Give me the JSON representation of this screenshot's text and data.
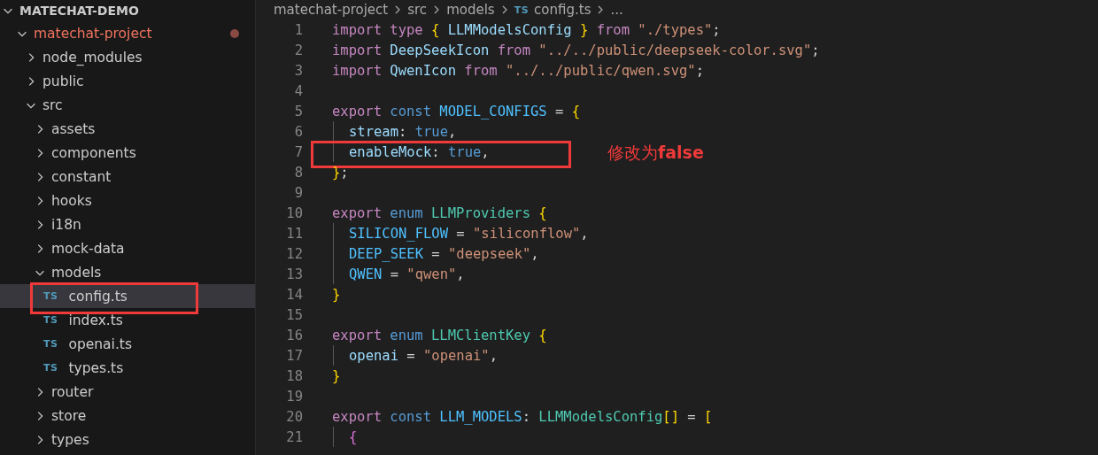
{
  "explorer": {
    "title": "MATECHAT-DEMO",
    "expanded": true,
    "items": [
      {
        "label": "matechat-project",
        "kind": "folder",
        "expanded": true,
        "modified": true,
        "selected": false,
        "children": [
          {
            "label": "node_modules",
            "kind": "folder",
            "expanded": false,
            "selected": false
          },
          {
            "label": "public",
            "kind": "folder",
            "expanded": false,
            "selected": false
          },
          {
            "label": "src",
            "kind": "folder",
            "expanded": true,
            "selected": false,
            "children": [
              {
                "label": "assets",
                "kind": "folder",
                "expanded": false,
                "selected": false
              },
              {
                "label": "components",
                "kind": "folder",
                "expanded": false,
                "selected": false
              },
              {
                "label": "constant",
                "kind": "folder",
                "expanded": false,
                "selected": false
              },
              {
                "label": "hooks",
                "kind": "folder",
                "expanded": false,
                "selected": false
              },
              {
                "label": "i18n",
                "kind": "folder",
                "expanded": false,
                "selected": false
              },
              {
                "label": "mock-data",
                "kind": "folder",
                "expanded": false,
                "selected": false
              },
              {
                "label": "models",
                "kind": "folder",
                "expanded": true,
                "selected": false,
                "children": [
                  {
                    "label": "config.ts",
                    "kind": "file",
                    "badge": "TS",
                    "selected": true,
                    "boxed": true
                  },
                  {
                    "label": "index.ts",
                    "kind": "file",
                    "badge": "TS",
                    "selected": false
                  },
                  {
                    "label": "openai.ts",
                    "kind": "file",
                    "badge": "TS",
                    "selected": false
                  },
                  {
                    "label": "types.ts",
                    "kind": "file",
                    "badge": "TS",
                    "selected": false
                  }
                ]
              },
              {
                "label": "router",
                "kind": "folder",
                "expanded": false,
                "selected": false
              },
              {
                "label": "store",
                "kind": "folder",
                "expanded": false,
                "selected": false
              },
              {
                "label": "types",
                "kind": "folder",
                "expanded": false,
                "selected": false
              }
            ]
          }
        ]
      }
    ]
  },
  "breadcrumb": {
    "parts": [
      "matechat-project",
      "src",
      "models"
    ],
    "file_badge": "TS",
    "file": "config.ts",
    "more": "..."
  },
  "code": [
    {
      "number": "1",
      "tokens": [
        {
          "t": "import",
          "kind": "keyword"
        },
        {
          "t": " type",
          "kind": "keyword"
        },
        {
          "t": " {",
          "kind": "bracket"
        },
        {
          "t": " LLMModelsConfig",
          "kind": "variable"
        },
        {
          "t": " }",
          "kind": "bracket"
        },
        {
          "t": " from",
          "kind": "keyword"
        },
        {
          "t": " \"./types\"",
          "kind": "string"
        },
        {
          "t": ";",
          "kind": "punct"
        }
      ]
    },
    {
      "number": "2",
      "tokens": [
        {
          "t": "import",
          "kind": "keyword"
        },
        {
          "t": " DeepSeekIcon",
          "kind": "variable"
        },
        {
          "t": " from",
          "kind": "keyword"
        },
        {
          "t": " \"../../public/deepseek-color.svg\"",
          "kind": "string"
        },
        {
          "t": ";",
          "kind": "punct"
        }
      ]
    },
    {
      "number": "3",
      "tokens": [
        {
          "t": "import",
          "kind": "keyword"
        },
        {
          "t": " QwenIcon",
          "kind": "variable"
        },
        {
          "t": " from",
          "kind": "keyword"
        },
        {
          "t": " \"../../public/qwen.svg\"",
          "kind": "string"
        },
        {
          "t": ";",
          "kind": "punct"
        }
      ]
    },
    {
      "number": "4"
    },
    {
      "number": "5",
      "tokens": [
        {
          "t": "export",
          "kind": "keyword"
        },
        {
          "t": " const",
          "kind": "storage"
        },
        {
          "t": " MODEL_CONFIGS",
          "kind": "constant"
        },
        {
          "t": " =",
          "kind": "punct"
        },
        {
          "t": " {",
          "kind": "bracket"
        }
      ]
    },
    {
      "number": "6",
      "indent": true,
      "tokens": [
        {
          "t": "stream",
          "kind": "variable"
        },
        {
          "t": ":",
          "kind": "punct"
        },
        {
          "t": " true",
          "kind": "storage"
        },
        {
          "t": ",",
          "kind": "punct"
        }
      ]
    },
    {
      "number": "7",
      "indent": true,
      "boxed": true,
      "tokens": [
        {
          "t": "enableMock",
          "kind": "variable"
        },
        {
          "t": ":",
          "kind": "punct"
        },
        {
          "t": " true",
          "kind": "storage"
        },
        {
          "t": ",",
          "kind": "punct"
        }
      ]
    },
    {
      "number": "8",
      "tokens": [
        {
          "t": "}",
          "kind": "bracket"
        },
        {
          "t": ";",
          "kind": "punct"
        }
      ]
    },
    {
      "number": "9"
    },
    {
      "number": "10",
      "tokens": [
        {
          "t": "export",
          "kind": "keyword"
        },
        {
          "t": " enum",
          "kind": "storage"
        },
        {
          "t": " LLMProviders",
          "kind": "class"
        },
        {
          "t": " {",
          "kind": "bracket"
        }
      ]
    },
    {
      "number": "11",
      "indent": true,
      "tokens": [
        {
          "t": "SILICON_FLOW",
          "kind": "constant"
        },
        {
          "t": " =",
          "kind": "punct"
        },
        {
          "t": " \"siliconflow\"",
          "kind": "string"
        },
        {
          "t": ",",
          "kind": "punct"
        }
      ]
    },
    {
      "number": "12",
      "indent": true,
      "tokens": [
        {
          "t": "DEEP_SEEK",
          "kind": "constant"
        },
        {
          "t": " =",
          "kind": "punct"
        },
        {
          "t": " \"deepseek\"",
          "kind": "string"
        },
        {
          "t": ",",
          "kind": "punct"
        }
      ]
    },
    {
      "number": "13",
      "indent": true,
      "tokens": [
        {
          "t": "QWEN",
          "kind": "constant"
        },
        {
          "t": " =",
          "kind": "punct"
        },
        {
          "t": " \"qwen\"",
          "kind": "string"
        },
        {
          "t": ",",
          "kind": "punct"
        }
      ]
    },
    {
      "number": "14",
      "tokens": [
        {
          "t": "}",
          "kind": "bracket"
        }
      ]
    },
    {
      "number": "15"
    },
    {
      "number": "16",
      "tokens": [
        {
          "t": "export",
          "kind": "keyword"
        },
        {
          "t": " enum",
          "kind": "storage"
        },
        {
          "t": " LLMClientKey",
          "kind": "class"
        },
        {
          "t": " {",
          "kind": "bracket"
        }
      ]
    },
    {
      "number": "17",
      "indent": true,
      "tokens": [
        {
          "t": "openai",
          "kind": "variable"
        },
        {
          "t": " =",
          "kind": "punct"
        },
        {
          "t": " \"openai\"",
          "kind": "string"
        },
        {
          "t": ",",
          "kind": "punct"
        }
      ]
    },
    {
      "number": "18",
      "tokens": [
        {
          "t": "}",
          "kind": "bracket"
        }
      ]
    },
    {
      "number": "19"
    },
    {
      "number": "20",
      "tokens": [
        {
          "t": "export",
          "kind": "keyword"
        },
        {
          "t": " const",
          "kind": "storage"
        },
        {
          "t": " LLM_MODELS",
          "kind": "constant"
        },
        {
          "t": ":",
          "kind": "punct"
        },
        {
          "t": " LLMModelsConfig",
          "kind": "class"
        },
        {
          "t": "[]",
          "kind": "bracket"
        },
        {
          "t": " =",
          "kind": "punct"
        },
        {
          "t": " [",
          "kind": "bracket"
        }
      ]
    },
    {
      "number": "21",
      "indent": true,
      "tokens": [
        {
          "t": "{",
          "kind": "bracket2"
        }
      ]
    }
  ],
  "annotation": {
    "text": "修改为**false**"
  }
}
